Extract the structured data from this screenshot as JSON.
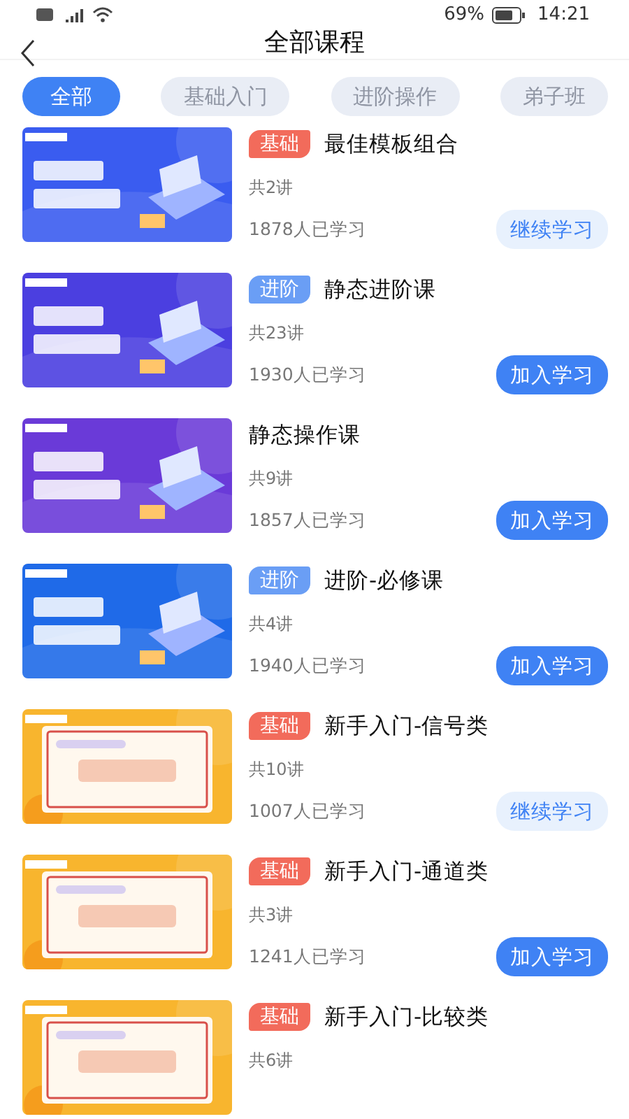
{
  "status_bar": {
    "battery_text": "69%",
    "time": "14:21"
  },
  "header": {
    "title": "全部课程"
  },
  "tabs": [
    {
      "label": "全部",
      "selected": true
    },
    {
      "label": "基础入门",
      "selected": false
    },
    {
      "label": "进阶操作",
      "selected": false
    },
    {
      "label": "弟子班",
      "selected": false
    }
  ],
  "courses": [
    {
      "tag": {
        "label": "基础",
        "color": "#f26b5b"
      },
      "title": "最佳模板组合",
      "lessons": "共2讲",
      "learners": "1878人已学习",
      "button": {
        "label": "继续学习",
        "kind": "continue"
      }
    },
    {
      "tag": {
        "label": "进阶",
        "color": "#6a9ef5"
      },
      "title": "静态进阶课",
      "lessons": "共23讲",
      "learners": "1930人已学习",
      "button": {
        "label": "加入学习",
        "kind": "join"
      }
    },
    {
      "title": "静态操作课",
      "lessons": "共9讲",
      "learners": "1857人已学习",
      "button": {
        "label": "加入学习",
        "kind": "join"
      }
    },
    {
      "tag": {
        "label": "进阶",
        "color": "#6a9ef5"
      },
      "title": "进阶-必修课",
      "lessons": "共4讲",
      "learners": "1940人已学习",
      "button": {
        "label": "加入学习",
        "kind": "join"
      }
    },
    {
      "tag": {
        "label": "基础",
        "color": "#f26b5b"
      },
      "title": "新手入门-信号类",
      "lessons": "共10讲",
      "learners": "1007人已学习",
      "button": {
        "label": "继续学习",
        "kind": "continue"
      }
    },
    {
      "tag": {
        "label": "基础",
        "color": "#f26b5b"
      },
      "title": "新手入门-通道类",
      "lessons": "共3讲",
      "learners": "1241人已学习",
      "button": {
        "label": "加入学习",
        "kind": "join"
      }
    },
    {
      "tag": {
        "label": "基础",
        "color": "#f26b5b"
      },
      "title": "新手入门-比较类",
      "lessons": "共6讲"
    }
  ]
}
